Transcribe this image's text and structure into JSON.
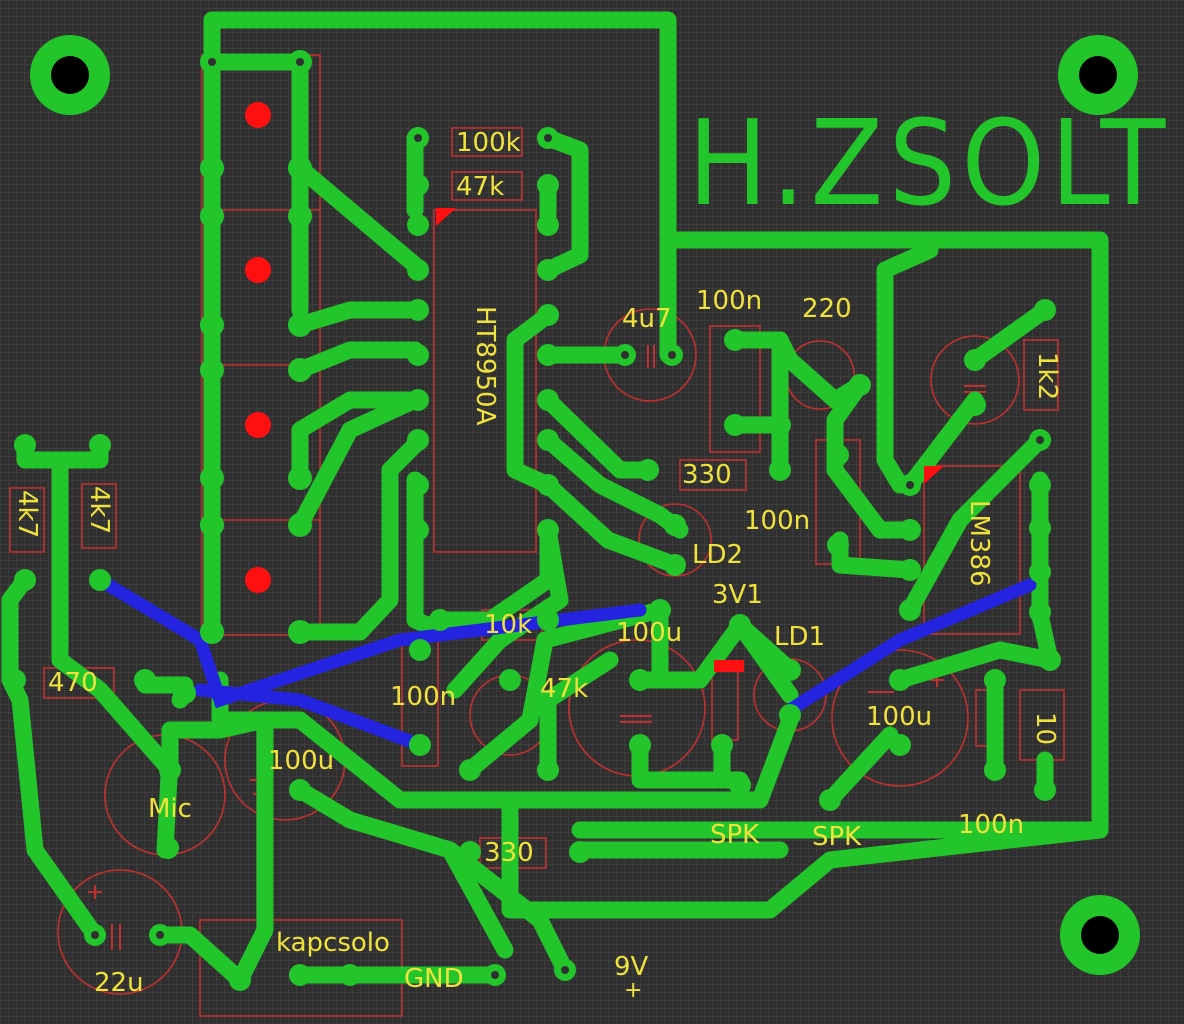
{
  "board": {
    "background": "#303030",
    "grid_color": "#4a4a4a",
    "trace_color": "#22c62a",
    "jumper_color": "#2424e0",
    "outline_color": "#c03030",
    "label_color": "#f0e23c",
    "marker_color": "#ff1010"
  },
  "title": "H.ZSOLT",
  "labels": {
    "r100k": "100k",
    "r47k_top": "47k",
    "ic1": "HT8950A",
    "c4u7": "4u7",
    "c100n_top": "100n",
    "r220": "220",
    "r1k2": "1k2",
    "r330_mid": "330",
    "c100n_mid": "100n",
    "ic2": "LM386",
    "ld2": "LD2",
    "v3v1": "3V1",
    "ld1": "LD1",
    "r10k": "10k",
    "c100u_center": "100u",
    "r47k_mid": "47k",
    "c100n_left": "100n",
    "r4k7_a": "4k7",
    "r4k7_b": "4k7",
    "r470": "470",
    "c100u_left": "100u",
    "mic": "Mic",
    "c100u_right": "100u",
    "r10": "10",
    "spk1": "SPK",
    "spk2": "SPK",
    "r330_bottom": "330",
    "c100n_right": "100n",
    "switch": "kapcsolo",
    "gnd": "GND",
    "v9": "9V",
    "plus": "+",
    "c22u": "22u"
  }
}
